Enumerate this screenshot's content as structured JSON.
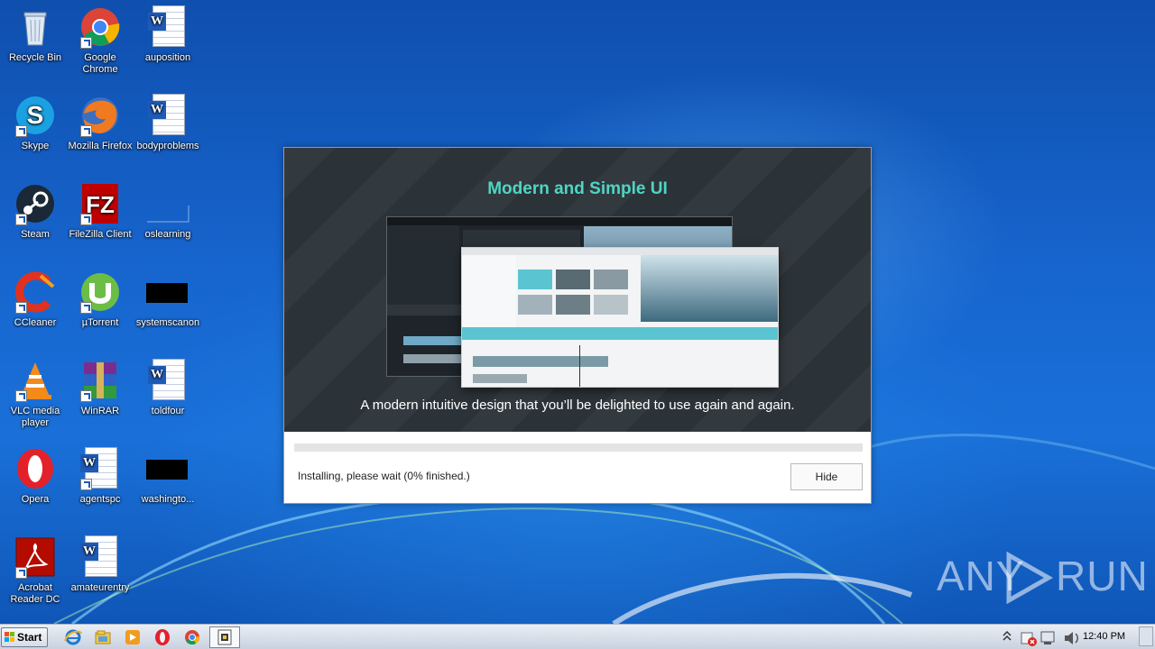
{
  "desktop_icons": [
    {
      "label": "Recycle Bin",
      "icon": "recycle-bin-icon"
    },
    {
      "label": "Google Chrome",
      "icon": "chrome-icon"
    },
    {
      "label": "auposition",
      "icon": "word-document-icon"
    },
    {
      "label": "Skype",
      "icon": "skype-icon"
    },
    {
      "label": "Mozilla Firefox",
      "icon": "firefox-icon"
    },
    {
      "label": "bodyproblems",
      "icon": "word-document-icon"
    },
    {
      "label": "Steam",
      "icon": "steam-icon"
    },
    {
      "label": "FileZilla Client",
      "icon": "filezilla-icon"
    },
    {
      "label": "oslearning",
      "icon": "blank-file-icon"
    },
    {
      "label": "CCleaner",
      "icon": "ccleaner-icon"
    },
    {
      "label": "µTorrent",
      "icon": "utorrent-icon"
    },
    {
      "label": "systemscanon",
      "icon": "black-image-icon"
    },
    {
      "label": "VLC media player",
      "icon": "vlc-icon"
    },
    {
      "label": "WinRAR",
      "icon": "winrar-icon"
    },
    {
      "label": "toldfour",
      "icon": "word-document-icon"
    },
    {
      "label": "Opera",
      "icon": "opera-icon"
    },
    {
      "label": "agentspc",
      "icon": "word-document-icon"
    },
    {
      "label": "washingto...",
      "icon": "black-image-icon"
    },
    {
      "label": "Acrobat Reader DC",
      "icon": "acrobat-icon"
    },
    {
      "label": "amateurentry",
      "icon": "word-document-icon"
    }
  ],
  "installer": {
    "banner_title": "Modern and Simple UI",
    "banner_subtitle": "A modern intuitive design that you’ll be delighted to use again and again.",
    "progress": 0,
    "status_text": "Installing, please wait (0% finished.)",
    "hide_label": "Hide",
    "accent_color": "#4fd5c4"
  },
  "watermark": {
    "left": "ANY",
    "right": "RUN"
  },
  "taskbar": {
    "start_label": "Start",
    "pinned": [
      "internet-explorer-icon",
      "explorer-icon",
      "media-player-icon",
      "opera-icon",
      "chrome-icon",
      "installer-icon"
    ],
    "clock": "12:40 PM"
  }
}
